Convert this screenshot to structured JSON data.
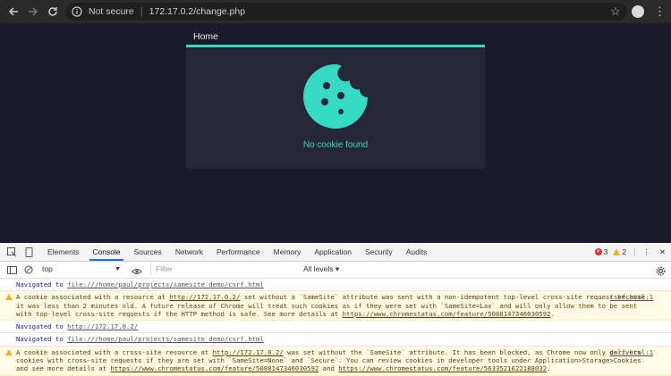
{
  "browser": {
    "security_label": "Not secure",
    "url": "172.17.0.2/change.php"
  },
  "page": {
    "tab_label": "Home",
    "message": "No cookie found",
    "accent_color": "#35d9c4"
  },
  "devtools": {
    "tabs": [
      "Elements",
      "Console",
      "Sources",
      "Network",
      "Performance",
      "Memory",
      "Application",
      "Security",
      "Audits"
    ],
    "active_tab": "Console",
    "error_count": "3",
    "warning_count": "2",
    "context": "top",
    "filter_placeholder": "Filter",
    "levels": "All levels ▾"
  },
  "console": {
    "nav1_label": "Navigated to",
    "nav1_url": "file:///home/paul/projects/samesite_demo/csrf.html",
    "warn1_pre": "A cookie associated with a resource at ",
    "warn1_link": "http://172.17.0.2/",
    "warn1_text": " set without a `SameSite` attribute was sent with a non-idempotent top-level cross-site request because it was less than 2 minutes old. A future release of Chrome will treat such cookies as if they were set with `SameSite=Lax` and will only allow them to be sent with top-level cross-site requests if the HTTP method is safe. See more details at ",
    "warn1_link2": "https://www.chromestatus.com/feature/5088147346030592",
    "warn1_end": ".",
    "warn1_src": "csrf.html:1",
    "nav2_label": "Navigated to",
    "nav2_url": "http://172.17.0.2/",
    "nav3_label": "Navigated to",
    "nav3_url": "file:///home/paul/projects/samesite_demo/csrf.html",
    "warn2_pre": "A cookie associated with a cross-site resource at ",
    "warn2_link": "http://172.17.0.2/",
    "warn2_text": " was set without the `SameSite` attribute. It has been blocked, as Chrome now only delivers cookies with cross-site requests if they are set with `SameSite=None` and `Secure`. You can review cookies in developer tools under Application>Storage>Cookies and see more details at ",
    "warn2_link2": "https://www.chromestatus.com/feature/5088147346030592",
    "warn2_and": " and ",
    "warn2_link3": "https://www.chromestatus.com/feature/5633521622188032",
    "warn2_end": ".",
    "warn2_src": "csrf.html:1"
  }
}
